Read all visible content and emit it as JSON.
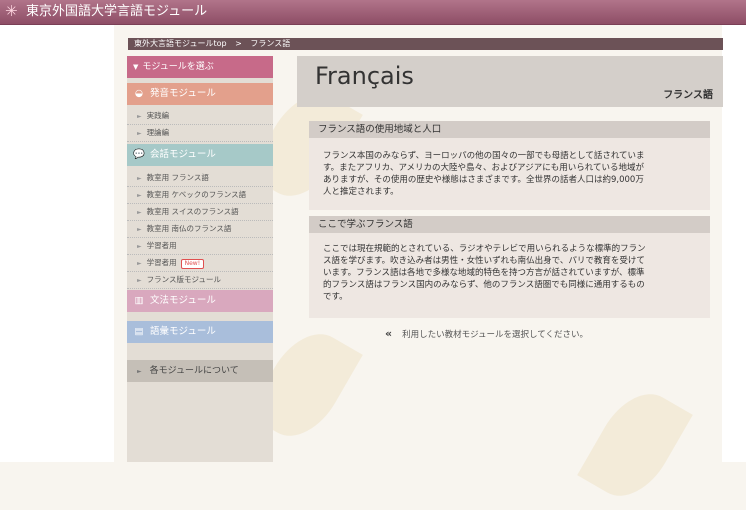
{
  "header": {
    "title": "東京外国語大学言語モジュール",
    "logo_icon": "snowflake-icon"
  },
  "breadcrumb": {
    "home": "東外大言語モジュールtop",
    "separator": ">",
    "current": "フランス語"
  },
  "sidebar": {
    "select_label": "モジュールを選ぶ",
    "pronunciation": {
      "label": "発音モジュール",
      "color": "#e3a08c",
      "items": [
        "実践編",
        "理論編"
      ]
    },
    "conversation": {
      "label": "会話モジュール",
      "color": "#a6c9c8",
      "items": [
        "教室用 フランス語",
        "教室用 ケベックのフランス語",
        "教室用 スイスのフランス語",
        "教室用 南仏のフランス語",
        "学習者用",
        "学習者用",
        "フランス版モジュール"
      ],
      "new_badge": "New!"
    },
    "grammar": {
      "label": "文法モジュール",
      "color": "#d9a8be"
    },
    "vocabulary": {
      "label": "語彙モジュール",
      "color": "#a9bedb"
    },
    "about": "各モジュールについて"
  },
  "main": {
    "title": "Français",
    "subtitle": "フランス語",
    "section1": {
      "heading": "フランス語の使用地域と人口",
      "lines": [
        "フランス本国のみならず、ヨーロッパの他の国々の一部でも母語として話されていま",
        "す。またアフリカ、アメリカの大陸や島々、およびアジアにも用いられている地域が",
        "ありますが、その使用の歴史や様態はさまざまです。全世界の話者人口は約9,000万",
        "人と推定されます。"
      ]
    },
    "section2": {
      "heading": "ここで学ぶフランス語",
      "lines": [
        "ここでは現在規範的とされている、ラジオやテレビで用いられるような標準的フラン",
        "ス語を学びます。吹き込み者は男性・女性いずれも南仏出身で、パリで教育を受けて",
        "います。フランス語は各地で多様な地域的特色を持つ方言が話されていますが、標準",
        "的フランス語はフランス国内のみならず、他のフランス語圏でも同様に通用するもの",
        "です。"
      ]
    },
    "prompt": "利用したい教材モジュールを選択してください。"
  }
}
